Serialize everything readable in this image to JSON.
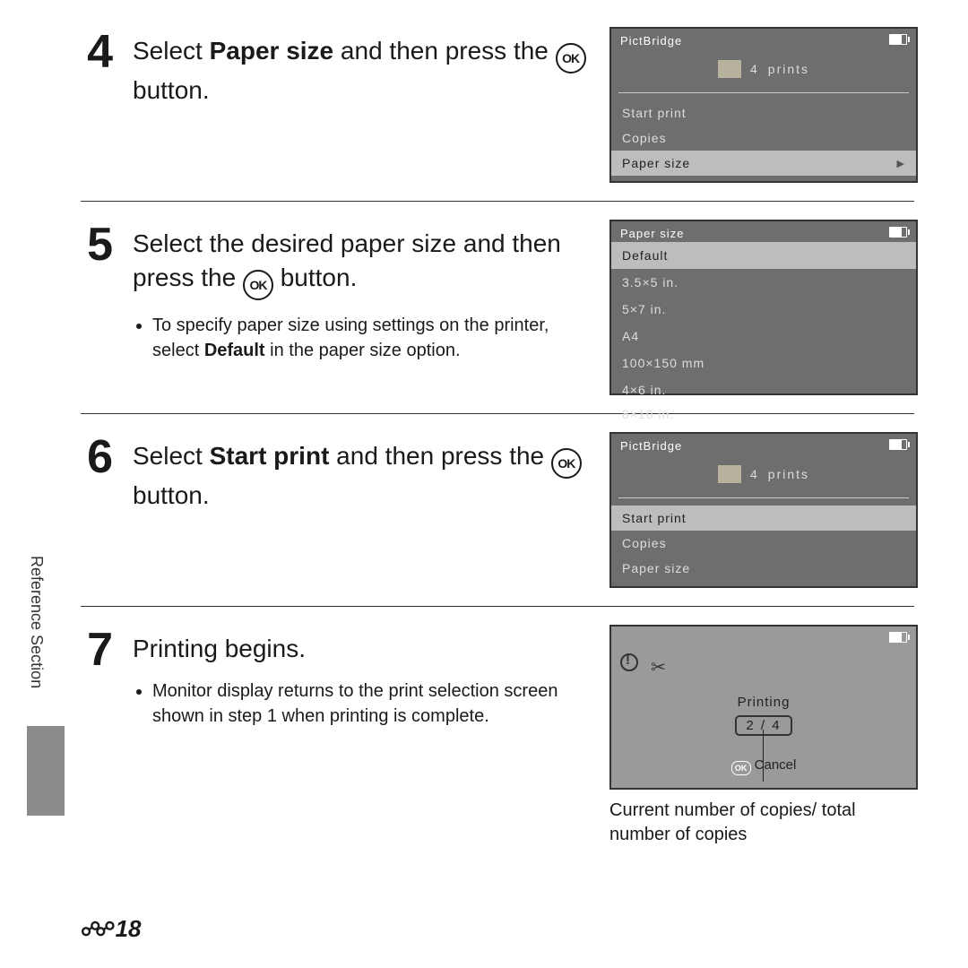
{
  "sideTab": "Reference Section",
  "pageNumber": "18",
  "steps": {
    "s4": {
      "num": "4",
      "text_a": "Select ",
      "text_bold": "Paper size",
      "text_b": " and then press the ",
      "text_c": " button.",
      "ok": "OK",
      "screen": {
        "title": "PictBridge",
        "prints_n": "4",
        "prints_w": "prints",
        "m1": "Start print",
        "m2": "Copies",
        "m3": "Paper size"
      }
    },
    "s5": {
      "num": "5",
      "text_a": "Select the desired paper size and then press the ",
      "text_b": " button.",
      "ok": "OK",
      "bullet_a": "To specify paper size using settings on the printer, select ",
      "bullet_bold": "Default",
      "bullet_b": " in the paper size option.",
      "screen": {
        "title": "Paper size",
        "o1": "Default",
        "o2": "3.5×5 in.",
        "o3": "5×7 in.",
        "o4": "A4",
        "o5": "100×150 mm",
        "o6": "4×6 in.",
        "o7": "8×10 in."
      }
    },
    "s6": {
      "num": "6",
      "text_a": "Select ",
      "text_bold": "Start print",
      "text_b": " and then press the ",
      "text_c": " button.",
      "ok": "OK",
      "screen": {
        "title": "PictBridge",
        "prints_n": "4",
        "prints_w": "prints",
        "m1": "Start print",
        "m2": "Copies",
        "m3": "Paper size"
      }
    },
    "s7": {
      "num": "7",
      "text": "Printing begins.",
      "bullet": "Monitor display returns to the print selection screen shown in step 1 when printing is complete.",
      "screen": {
        "printing": "Printing",
        "count": "2 / 4",
        "cancel": "Cancel",
        "ok": "OK"
      },
      "caption": "Current number of copies/ total number of copies"
    }
  }
}
